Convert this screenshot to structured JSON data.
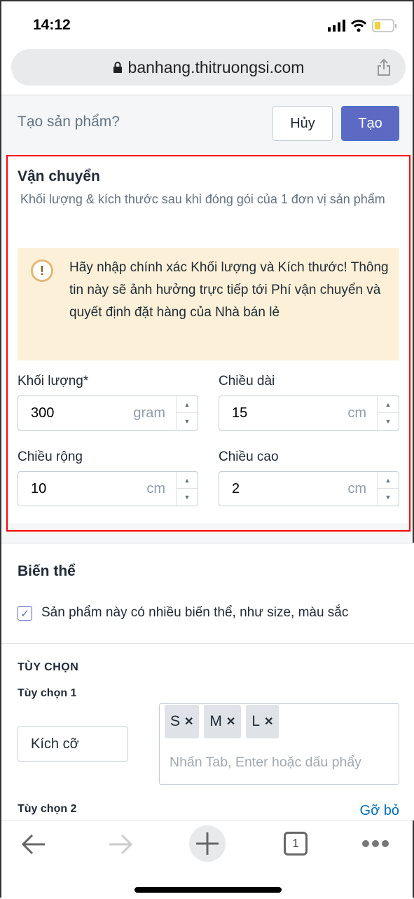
{
  "status_bar": {
    "time": "14:12",
    "icons": [
      "signal-icon",
      "wifi-icon",
      "battery-icon"
    ]
  },
  "browser": {
    "url": "banhang.thitruongsi.com",
    "icons": [
      "lock-icon",
      "share-icon"
    ]
  },
  "header": {
    "title": "Tạo sản phẩm?",
    "cancel_label": "Hủy",
    "create_label": "Tạo",
    "accent": "#5c6ac4"
  },
  "shipping": {
    "title": "Vận chuyển",
    "subtitle": "Khối lượng & kích thước sau khi đóng gói của 1 đơn vị sản phẩm",
    "warning": "Hãy nhập chính xác Khối lượng và Kích thước! Thông tin này sẽ ảnh hưởng trực tiếp tới Phí vận chuyển và quyết định đặt hàng của Nhà bán lẻ",
    "fields": [
      {
        "label": "Khối lượng*",
        "value": "300",
        "unit": "gram"
      },
      {
        "label": "Chiều dài",
        "value": "15",
        "unit": "cm"
      },
      {
        "label": "Chiều rộng",
        "value": "10",
        "unit": "cm"
      },
      {
        "label": "Chiều cao",
        "value": "2",
        "unit": "cm"
      }
    ]
  },
  "variants": {
    "title": "Biến thể",
    "checkbox_label": "Sản phẩm này có nhiều biến thể, như size, màu sắc",
    "checked": true,
    "options_heading": "TÙY CHỌN",
    "option1": {
      "label": "Tùy chọn 1",
      "name": "Kích cỡ",
      "tags": [
        "S",
        "M",
        "L"
      ],
      "placeholder": "Nhấn Tab, Enter hoặc dấu phẩy"
    },
    "option2": {
      "label": "Tùy chọn 2",
      "remove_label": "Gỡ bỏ"
    }
  },
  "toolbar": {
    "tab_count": "1"
  }
}
